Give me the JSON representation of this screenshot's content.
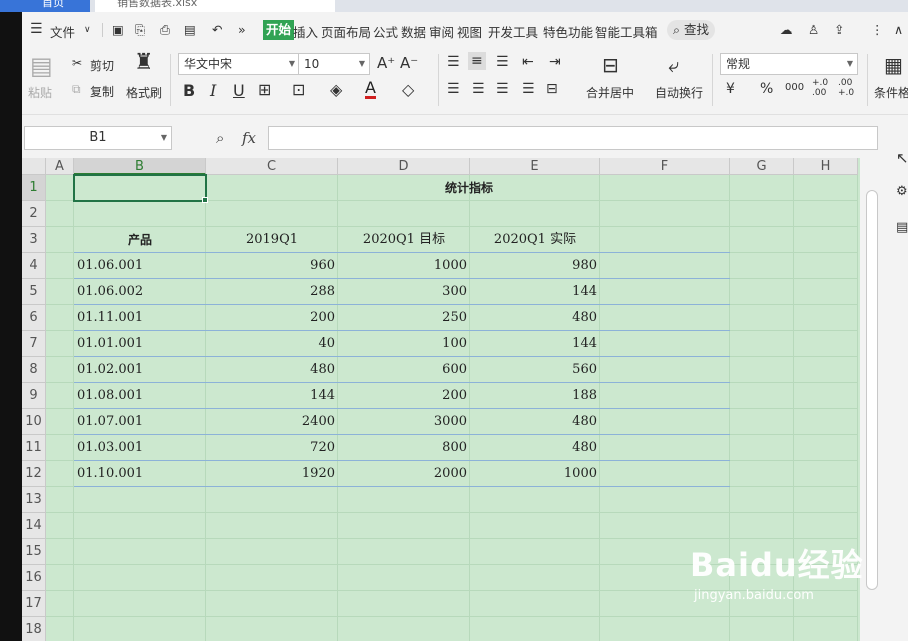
{
  "titlebar": {
    "home_tab": "首页",
    "file_tab": "销售数据表.xlsx"
  },
  "menubar": {
    "items": [
      "文件",
      "开始",
      "插入",
      "页面布局",
      "公式",
      "数据",
      "审阅",
      "视图",
      "开发工具",
      "特色功能",
      "智能工具箱"
    ],
    "active": "开始",
    "search_label": "查找"
  },
  "ribbon": {
    "paste": "粘贴",
    "cut": "剪切",
    "copy": "复制",
    "format_painter": "格式刷",
    "font_name": "华文中宋",
    "font_size": "10",
    "merge_center": "合并居中",
    "wrap_text": "自动换行",
    "number_format": "常规",
    "conditional": "条件格",
    "bold": "B",
    "italic": "I",
    "underline": "U",
    "font_color": "A",
    "currency": "¥",
    "percent": "%",
    "thousands": "000",
    "inc_decimal": "+.0 .00",
    "dec_decimal": ".00 +.0",
    "grow_font": "A⁺",
    "shrink_font": "A⁻"
  },
  "formula_bar": {
    "name_box": "B1",
    "fx_label": "fx",
    "formula": ""
  },
  "sheet": {
    "columns": [
      "A",
      "B",
      "C",
      "D",
      "E",
      "F",
      "G",
      "H"
    ],
    "selected_column": "B",
    "rows": [
      "1",
      "2",
      "3",
      "4",
      "5",
      "6",
      "7",
      "8",
      "9",
      "10",
      "11",
      "12",
      "13",
      "14",
      "15",
      "16",
      "17",
      "18"
    ],
    "title": "统计指标",
    "headers": [
      "产品",
      "2019Q1",
      "2020Q1 目标",
      "2020Q1 实际"
    ],
    "data": [
      [
        "01.06.001",
        "960",
        "1000",
        "980"
      ],
      [
        "01.06.002",
        "288",
        "300",
        "144"
      ],
      [
        "01.11.001",
        "200",
        "250",
        "480"
      ],
      [
        "01.01.001",
        "40",
        "100",
        "144"
      ],
      [
        "01.02.001",
        "480",
        "600",
        "560"
      ],
      [
        "01.08.001",
        "144",
        "200",
        "188"
      ],
      [
        "01.07.001",
        "2400",
        "3000",
        "480"
      ],
      [
        "01.03.001",
        "720",
        "800",
        "480"
      ],
      [
        "01.10.001",
        "1920",
        "2000",
        "1000"
      ]
    ]
  },
  "watermark": {
    "logo": "Baidu经验",
    "url": "jingyan.baidu.com"
  }
}
